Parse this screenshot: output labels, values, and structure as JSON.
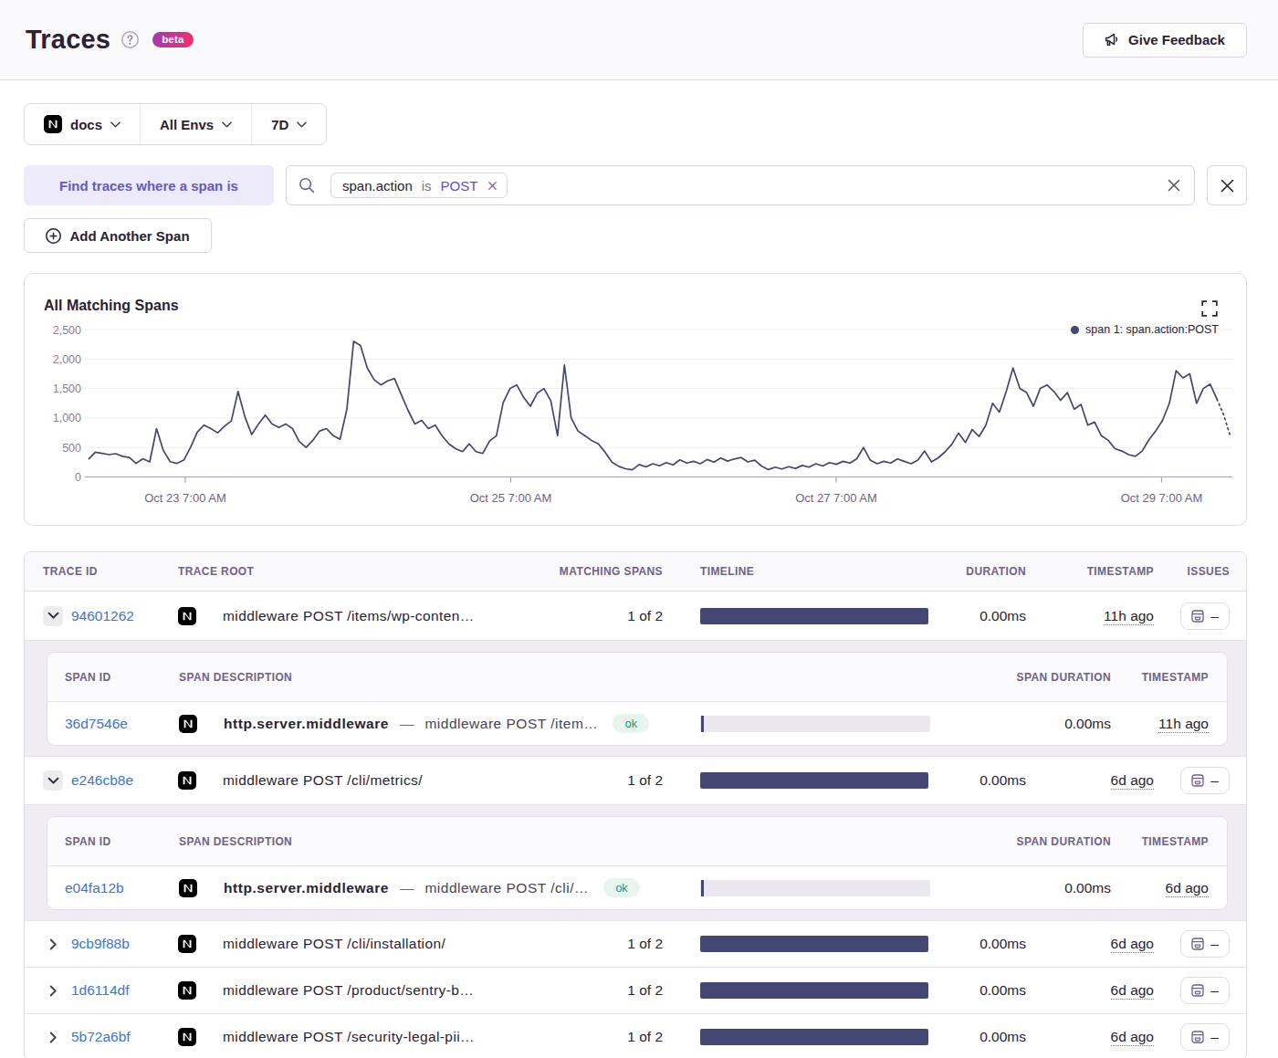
{
  "header": {
    "title": "Traces",
    "beta_badge": "beta",
    "feedback_button": "Give Feedback"
  },
  "page_filters": {
    "project": "docs",
    "environment": "All Envs",
    "date_range": "7D"
  },
  "span_filter": {
    "label": "Find traces where a span is",
    "token": {
      "key": "span.action",
      "op": "is",
      "value": "POST"
    },
    "add_button": "Add Another Span"
  },
  "chart_data": {
    "type": "line",
    "title": "All Matching Spans",
    "legend": [
      "span 1: span.action:POST"
    ],
    "legend_position": "top-right",
    "grid": true,
    "ylim": [
      0,
      2500
    ],
    "y_ticks": [
      "0",
      "500",
      "1,000",
      "1,500",
      "2,000",
      "2,500"
    ],
    "x_ticks": [
      "Oct 23 7:00 AM",
      "Oct 25 7:00 AM",
      "Oct 27 7:00 AM",
      "Oct 29 7:00 AM"
    ],
    "series": [
      {
        "name": "span 1: span.action:POST",
        "color": "#444674",
        "dotted_tail_points": 2,
        "values": [
          300,
          420,
          400,
          380,
          395,
          350,
          330,
          230,
          310,
          255,
          820,
          450,
          260,
          230,
          285,
          500,
          760,
          880,
          820,
          750,
          860,
          950,
          1450,
          1020,
          720,
          900,
          1050,
          900,
          840,
          900,
          820,
          600,
          500,
          620,
          780,
          820,
          700,
          640,
          1150,
          2300,
          2230,
          1850,
          1650,
          1560,
          1630,
          1670,
          1400,
          1130,
          900,
          960,
          820,
          880,
          700,
          560,
          480,
          430,
          560,
          430,
          400,
          610,
          700,
          1260,
          1500,
          1560,
          1350,
          1200,
          1420,
          1500,
          1290,
          700,
          1900,
          1000,
          780,
          700,
          620,
          560,
          420,
          250,
          180,
          140,
          120,
          210,
          170,
          225,
          190,
          245,
          205,
          290,
          235,
          265,
          225,
          295,
          250,
          320,
          270,
          305,
          330,
          255,
          285,
          185,
          125,
          165,
          135,
          175,
          145,
          195,
          165,
          225,
          185,
          245,
          215,
          265,
          235,
          305,
          500,
          285,
          225,
          265,
          235,
          305,
          265,
          225,
          285,
          440,
          255,
          325,
          425,
          555,
          745,
          585,
          805,
          685,
          875,
          1250,
          1100,
          1450,
          1850,
          1500,
          1430,
          1200,
          1500,
          1560,
          1450,
          1300,
          1430,
          1150,
          1230,
          880,
          930,
          700,
          620,
          480,
          440,
          380,
          350,
          440,
          630,
          780,
          960,
          1250,
          1800,
          1680,
          1750,
          1250,
          1500,
          1575,
          1320,
          1050,
          680
        ]
      }
    ]
  },
  "table": {
    "columns": [
      "TRACE ID",
      "TRACE ROOT",
      "MATCHING SPANS",
      "TIMELINE",
      "DURATION",
      "TIMESTAMP",
      "ISSUES"
    ],
    "span_columns": [
      "SPAN ID",
      "SPAN DESCRIPTION",
      "SPAN DURATION",
      "TIMESTAMP"
    ],
    "rows": [
      {
        "expanded": true,
        "trace_id": "94601262",
        "trace_root": "middleware POST /items/wp-conten…",
        "matching_spans": "1 of 2",
        "duration": "0.00ms",
        "timestamp": "11h ago",
        "issues": "–",
        "spans": [
          {
            "span_id": "36d7546e",
            "op": "http.server.middleware",
            "description": "middleware POST /item…",
            "status": "ok",
            "duration": "0.00ms",
            "timestamp": "11h ago"
          }
        ]
      },
      {
        "expanded": true,
        "trace_id": "e246cb8e",
        "trace_root": "middleware POST /cli/metrics/",
        "matching_spans": "1 of 2",
        "duration": "0.00ms",
        "timestamp": "6d ago",
        "issues": "–",
        "spans": [
          {
            "span_id": "e04fa12b",
            "op": "http.server.middleware",
            "description": "middleware POST /cli/…",
            "status": "ok",
            "duration": "0.00ms",
            "timestamp": "6d ago"
          }
        ]
      },
      {
        "expanded": false,
        "trace_id": "9cb9f88b",
        "trace_root": "middleware POST /cli/installation/",
        "matching_spans": "1 of 2",
        "duration": "0.00ms",
        "timestamp": "6d ago",
        "issues": "–",
        "spans": []
      },
      {
        "expanded": false,
        "trace_id": "1d6114df",
        "trace_root": "middleware POST /product/sentry-b…",
        "matching_spans": "1 of 2",
        "duration": "0.00ms",
        "timestamp": "6d ago",
        "issues": "–",
        "spans": []
      },
      {
        "expanded": false,
        "trace_id": "5b72a6bf",
        "trace_root": "middleware POST /security-legal-pii…",
        "matching_spans": "1 of 2",
        "duration": "0.00ms",
        "timestamp": "6d ago",
        "issues": "–",
        "spans": []
      }
    ]
  },
  "colors": {
    "accent_purple": "#6559c5",
    "token_value": "#5b4bdb",
    "link_blue": "#3d74db",
    "chart_line": "#444674",
    "timeline_bar": "#444674",
    "ok_green": "#268d75",
    "beta_gradient_start": "#a737b4",
    "beta_gradient_end": "#f2306f"
  }
}
